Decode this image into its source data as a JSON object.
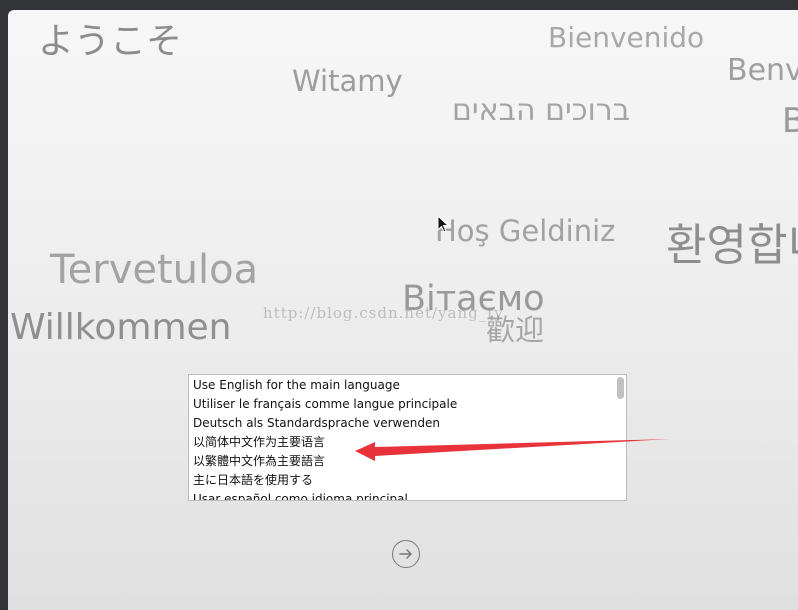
{
  "greetings": {
    "japanese": "ようこそ",
    "bienvenido": "Bienvenido",
    "witamy": "Witamy",
    "benv": "Benv",
    "hebrew": "ברוכים הבאים",
    "b": "B",
    "turkish": "Hoş Geldiniz",
    "korean": "환영합니",
    "finnish": "Tervetuloa",
    "ukrainian": "Вітаємо",
    "german": "Willkommen",
    "chinese": "歡迎"
  },
  "watermark": "http://blog.csdn.net/yang_ty",
  "language_list": {
    "items": [
      "Use English for the main language",
      "Utiliser le français comme langue principale",
      "Deutsch als Standardsprache verwenden",
      "以简体中文作为主要语言",
      "以繁體中文作為主要語言",
      "主に日本語を使用する",
      "Usar español como idioma principal"
    ]
  },
  "annotation": {
    "arrow_color": "#e8333a"
  },
  "continue_button": {
    "icon": "arrow-right-circle-icon"
  }
}
